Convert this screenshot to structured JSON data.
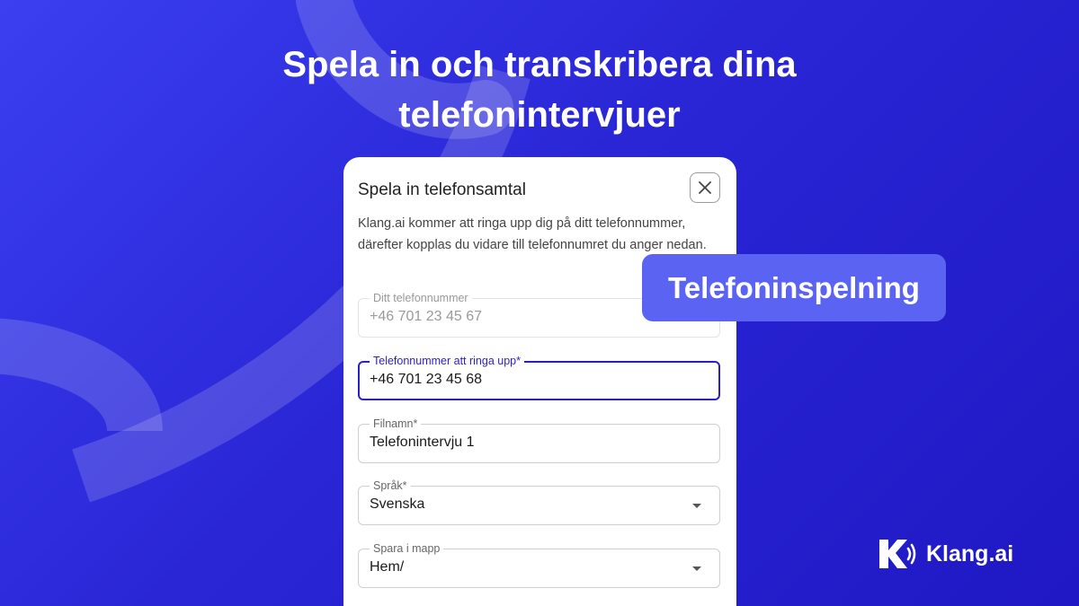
{
  "headline": {
    "line1": "Spela in och transkribera dina",
    "line2": "telefonintervjuer"
  },
  "dialog": {
    "title": "Spela in telefonsamtal",
    "close_icon": "close-icon",
    "description": "Klang.ai kommer att ringa upp dig på ditt telefonnummer, därefter kopplas du vidare till telefonnumret du anger nedan.",
    "fields": {
      "my_number": {
        "label": "Ditt telefonnummer",
        "value": "+46 701 23 45 67",
        "state": "disabled"
      },
      "call_number": {
        "label": "Telefonnummer att ringa upp*",
        "value": "+46 701 23 45 68",
        "state": "focused"
      },
      "filename": {
        "label": "Filnamn*",
        "value": "Telefonintervju 1"
      },
      "language": {
        "label": "Språk*",
        "value": "Svenska",
        "icon": "chevron-down-icon"
      },
      "folder": {
        "label": "Spara i mapp",
        "value": "Hem/",
        "icon": "chevron-down-icon"
      }
    }
  },
  "badge": {
    "text": "Telefoninspelning"
  },
  "brand": {
    "name": "Klang.ai",
    "icon": "klang-logo-icon"
  },
  "colors": {
    "background": "#2a26d6",
    "accent": "#2a1fc7",
    "badge": "#5b63f2"
  }
}
